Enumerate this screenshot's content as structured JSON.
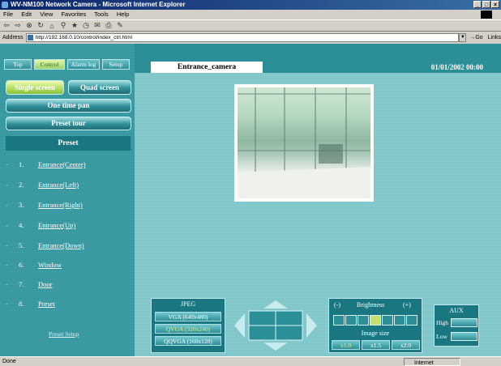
{
  "window": {
    "title": "WV-NM100 Network Camera - Microsoft Internet Explorer",
    "controls": [
      "_",
      "□",
      "×"
    ]
  },
  "menu": [
    "File",
    "Edit",
    "View",
    "Favorites",
    "Tools",
    "Help"
  ],
  "toolbar_icons": [
    "back-icon",
    "forward-icon",
    "stop-icon",
    "refresh-icon",
    "home-icon",
    "search-icon",
    "favorites-icon",
    "history-icon",
    "mail-icon",
    "print-icon",
    "edit-icon"
  ],
  "address": {
    "label": "Address",
    "url": "http://192.168.0.10/control/index_ctrl.html",
    "go": "Go",
    "links": "Links"
  },
  "tabs": [
    "Top",
    "Control",
    "Alarm log",
    "Setup"
  ],
  "screen_buttons": {
    "single": "Single screen",
    "quad": "Quad screen"
  },
  "one_time_pan": "One time pan",
  "preset_tour": "Preset tour",
  "preset": {
    "header": "Preset",
    "items": [
      {
        "num": "1.",
        "label": "Entrance(Center)"
      },
      {
        "num": "2.",
        "label": "Entrance(Left)"
      },
      {
        "num": "3.",
        "label": "Entrance(Right)"
      },
      {
        "num": "4.",
        "label": "Entrance(Up)"
      },
      {
        "num": "5.",
        "label": "Entrance(Down)"
      },
      {
        "num": "6.",
        "label": "Window"
      },
      {
        "num": "7.",
        "label": "Door"
      },
      {
        "num": "8.",
        "label": "Preset"
      }
    ],
    "setup_link": "Preset Setup"
  },
  "camera_title": "Entrance_camera",
  "datetime": "01/01/2002  00:00",
  "jpeg": {
    "title": "JPEG",
    "options": [
      "VGA (640x480)",
      "QVGA (320x240)",
      "QQVGA (160x120)"
    ],
    "selected": 1
  },
  "brightness": {
    "minus": "(-)",
    "label": "Brightness",
    "plus": "(+)",
    "level": 4,
    "steps": 7
  },
  "image_size": {
    "title": "Image size",
    "options": [
      "x1.0",
      "x1.5",
      "x2.0"
    ],
    "selected": 0
  },
  "aux": {
    "title": "AUX",
    "high": "High",
    "low": "Low"
  },
  "status": {
    "left": "Done",
    "zone": "Internet"
  },
  "colors": {
    "accent": "#1a7782",
    "selected": "#c7e06b",
    "background": "#86cbcd"
  }
}
